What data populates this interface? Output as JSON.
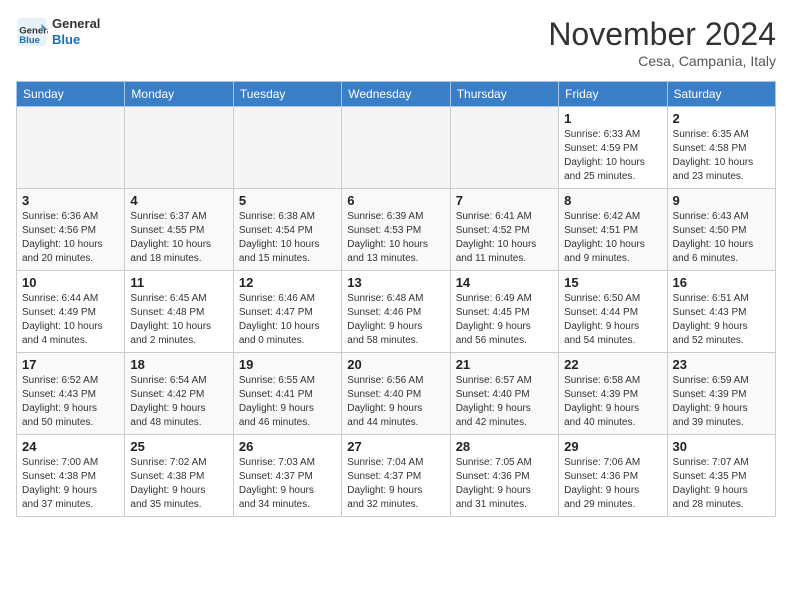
{
  "header": {
    "logo_line1": "General",
    "logo_line2": "Blue",
    "month": "November 2024",
    "location": "Cesa, Campania, Italy"
  },
  "weekdays": [
    "Sunday",
    "Monday",
    "Tuesday",
    "Wednesday",
    "Thursday",
    "Friday",
    "Saturday"
  ],
  "weeks": [
    [
      {
        "day": "",
        "info": ""
      },
      {
        "day": "",
        "info": ""
      },
      {
        "day": "",
        "info": ""
      },
      {
        "day": "",
        "info": ""
      },
      {
        "day": "",
        "info": ""
      },
      {
        "day": "1",
        "info": "Sunrise: 6:33 AM\nSunset: 4:59 PM\nDaylight: 10 hours\nand 25 minutes."
      },
      {
        "day": "2",
        "info": "Sunrise: 6:35 AM\nSunset: 4:58 PM\nDaylight: 10 hours\nand 23 minutes."
      }
    ],
    [
      {
        "day": "3",
        "info": "Sunrise: 6:36 AM\nSunset: 4:56 PM\nDaylight: 10 hours\nand 20 minutes."
      },
      {
        "day": "4",
        "info": "Sunrise: 6:37 AM\nSunset: 4:55 PM\nDaylight: 10 hours\nand 18 minutes."
      },
      {
        "day": "5",
        "info": "Sunrise: 6:38 AM\nSunset: 4:54 PM\nDaylight: 10 hours\nand 15 minutes."
      },
      {
        "day": "6",
        "info": "Sunrise: 6:39 AM\nSunset: 4:53 PM\nDaylight: 10 hours\nand 13 minutes."
      },
      {
        "day": "7",
        "info": "Sunrise: 6:41 AM\nSunset: 4:52 PM\nDaylight: 10 hours\nand 11 minutes."
      },
      {
        "day": "8",
        "info": "Sunrise: 6:42 AM\nSunset: 4:51 PM\nDaylight: 10 hours\nand 9 minutes."
      },
      {
        "day": "9",
        "info": "Sunrise: 6:43 AM\nSunset: 4:50 PM\nDaylight: 10 hours\nand 6 minutes."
      }
    ],
    [
      {
        "day": "10",
        "info": "Sunrise: 6:44 AM\nSunset: 4:49 PM\nDaylight: 10 hours\nand 4 minutes."
      },
      {
        "day": "11",
        "info": "Sunrise: 6:45 AM\nSunset: 4:48 PM\nDaylight: 10 hours\nand 2 minutes."
      },
      {
        "day": "12",
        "info": "Sunrise: 6:46 AM\nSunset: 4:47 PM\nDaylight: 10 hours\nand 0 minutes."
      },
      {
        "day": "13",
        "info": "Sunrise: 6:48 AM\nSunset: 4:46 PM\nDaylight: 9 hours\nand 58 minutes."
      },
      {
        "day": "14",
        "info": "Sunrise: 6:49 AM\nSunset: 4:45 PM\nDaylight: 9 hours\nand 56 minutes."
      },
      {
        "day": "15",
        "info": "Sunrise: 6:50 AM\nSunset: 4:44 PM\nDaylight: 9 hours\nand 54 minutes."
      },
      {
        "day": "16",
        "info": "Sunrise: 6:51 AM\nSunset: 4:43 PM\nDaylight: 9 hours\nand 52 minutes."
      }
    ],
    [
      {
        "day": "17",
        "info": "Sunrise: 6:52 AM\nSunset: 4:43 PM\nDaylight: 9 hours\nand 50 minutes."
      },
      {
        "day": "18",
        "info": "Sunrise: 6:54 AM\nSunset: 4:42 PM\nDaylight: 9 hours\nand 48 minutes."
      },
      {
        "day": "19",
        "info": "Sunrise: 6:55 AM\nSunset: 4:41 PM\nDaylight: 9 hours\nand 46 minutes."
      },
      {
        "day": "20",
        "info": "Sunrise: 6:56 AM\nSunset: 4:40 PM\nDaylight: 9 hours\nand 44 minutes."
      },
      {
        "day": "21",
        "info": "Sunrise: 6:57 AM\nSunset: 4:40 PM\nDaylight: 9 hours\nand 42 minutes."
      },
      {
        "day": "22",
        "info": "Sunrise: 6:58 AM\nSunset: 4:39 PM\nDaylight: 9 hours\nand 40 minutes."
      },
      {
        "day": "23",
        "info": "Sunrise: 6:59 AM\nSunset: 4:39 PM\nDaylight: 9 hours\nand 39 minutes."
      }
    ],
    [
      {
        "day": "24",
        "info": "Sunrise: 7:00 AM\nSunset: 4:38 PM\nDaylight: 9 hours\nand 37 minutes."
      },
      {
        "day": "25",
        "info": "Sunrise: 7:02 AM\nSunset: 4:38 PM\nDaylight: 9 hours\nand 35 minutes."
      },
      {
        "day": "26",
        "info": "Sunrise: 7:03 AM\nSunset: 4:37 PM\nDaylight: 9 hours\nand 34 minutes."
      },
      {
        "day": "27",
        "info": "Sunrise: 7:04 AM\nSunset: 4:37 PM\nDaylight: 9 hours\nand 32 minutes."
      },
      {
        "day": "28",
        "info": "Sunrise: 7:05 AM\nSunset: 4:36 PM\nDaylight: 9 hours\nand 31 minutes."
      },
      {
        "day": "29",
        "info": "Sunrise: 7:06 AM\nSunset: 4:36 PM\nDaylight: 9 hours\nand 29 minutes."
      },
      {
        "day": "30",
        "info": "Sunrise: 7:07 AM\nSunset: 4:35 PM\nDaylight: 9 hours\nand 28 minutes."
      }
    ]
  ]
}
